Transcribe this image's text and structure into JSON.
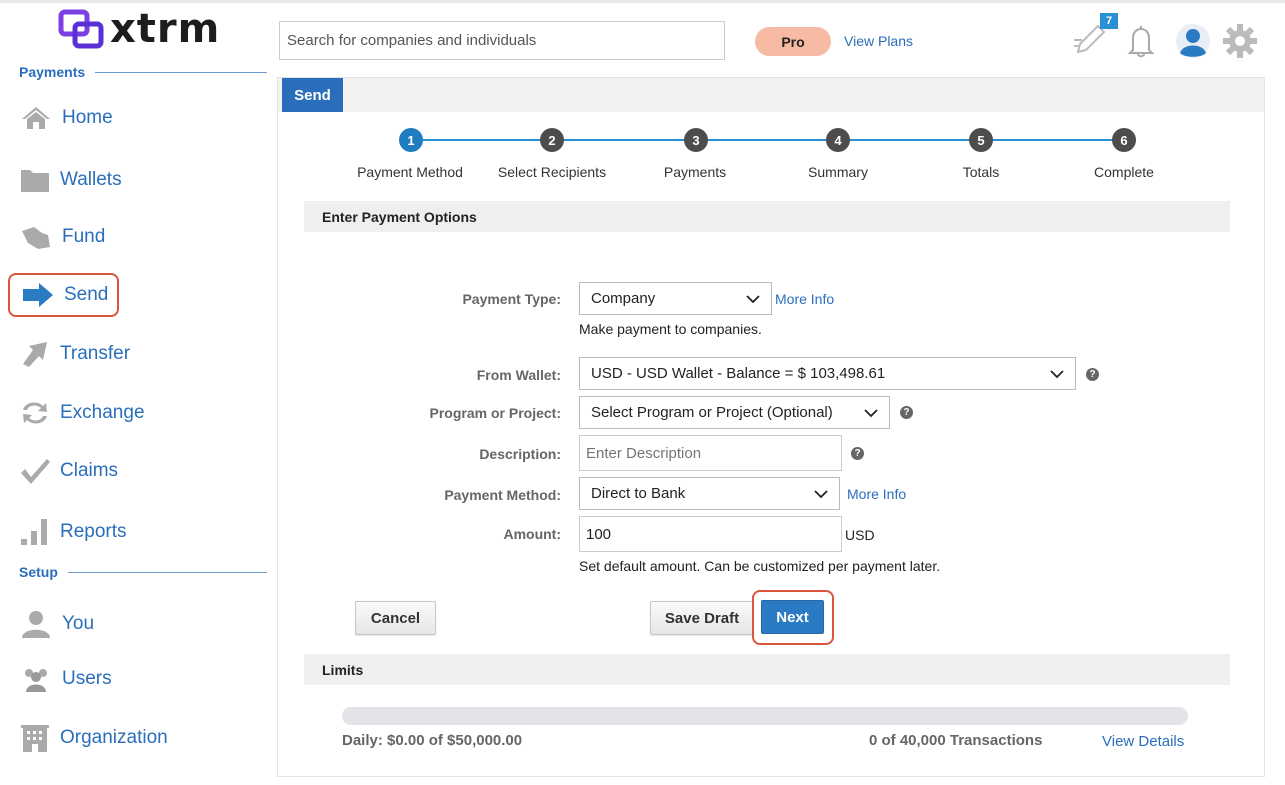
{
  "brand": {
    "name": "xtrm",
    "accent": "#2a6ebb",
    "logo_color": "#7b3fe4"
  },
  "header": {
    "search_placeholder": "Search for companies and individuals",
    "plan_badge": "Pro",
    "view_plans": "View Plans",
    "notification_count": "7"
  },
  "sidebar": {
    "sections": [
      {
        "title": "Payments"
      },
      {
        "title": "Setup"
      }
    ],
    "items": [
      {
        "label": "Home",
        "icon": "home-icon"
      },
      {
        "label": "Wallets",
        "icon": "folder-icon"
      },
      {
        "label": "Fund",
        "icon": "fund-icon"
      },
      {
        "label": "Send",
        "icon": "send-arrow-icon",
        "active": true
      },
      {
        "label": "Transfer",
        "icon": "transfer-icon"
      },
      {
        "label": "Exchange",
        "icon": "exchange-icon"
      },
      {
        "label": "Claims",
        "icon": "check-icon"
      },
      {
        "label": "Reports",
        "icon": "bar-chart-icon"
      },
      {
        "label": "You",
        "icon": "user-icon"
      },
      {
        "label": "Users",
        "icon": "users-icon"
      },
      {
        "label": "Organization",
        "icon": "building-icon"
      }
    ]
  },
  "tab": {
    "label": "Send"
  },
  "steps": [
    {
      "num": "1",
      "label": "Payment Method",
      "active": true
    },
    {
      "num": "2",
      "label": "Select Recipients"
    },
    {
      "num": "3",
      "label": "Payments"
    },
    {
      "num": "4",
      "label": "Summary"
    },
    {
      "num": "5",
      "label": "Totals"
    },
    {
      "num": "6",
      "label": "Complete"
    }
  ],
  "form": {
    "section_title": "Enter Payment Options",
    "payment_type": {
      "label": "Payment Type:",
      "value": "Company",
      "more_info": "More Info",
      "hint": "Make payment to companies."
    },
    "from_wallet": {
      "label": "From Wallet:",
      "value": "USD - USD Wallet - Balance = $ 103,498.61"
    },
    "program": {
      "label": "Program or Project:",
      "value": "Select Program or Project (Optional)"
    },
    "description": {
      "label": "Description:",
      "placeholder": "Enter Description"
    },
    "payment_method": {
      "label": "Payment Method:",
      "value": "Direct to Bank",
      "more_info": "More Info"
    },
    "amount": {
      "label": "Amount:",
      "value": "100",
      "currency": "USD",
      "hint": "Set default amount. Can be customized per payment later."
    },
    "buttons": {
      "cancel": "Cancel",
      "save_draft": "Save Draft",
      "next": "Next"
    }
  },
  "limits": {
    "title": "Limits",
    "daily": "Daily: $0.00 of $50,000.00",
    "transactions": "0 of 40,000 Transactions",
    "view_details": "View Details",
    "used_fraction": 0
  }
}
